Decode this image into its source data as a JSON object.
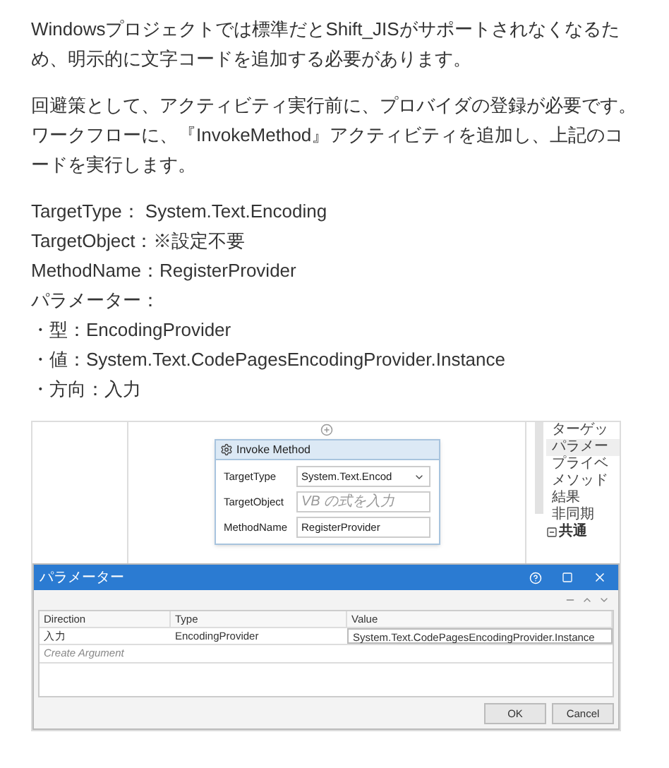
{
  "paragraphs": [
    "Windowsプロジェクトでは標準だとShift_JISがサポートされなくなるため、明示的に文字コードを追加する必要があります。",
    "回避策として、アクティビティ実行前に、プロバイダの登録が必要です。ワークフローに、『InvokeMethod』アクティビティを追加し、上記のコードを実行します。"
  ],
  "settings": [
    "TargetType： System.Text.Encoding",
    "TargetObject：※設定不要",
    "MethodName：RegisterProvider",
    "パラメーター：",
    "・型：EncodingProvider",
    "・値：System.Text.CodePagesEncodingProvider.Instance",
    "・方向：入力"
  ],
  "screenshot": {
    "activity": {
      "title": "Invoke Method",
      "fields": [
        {
          "label": "TargetType",
          "kind": "select",
          "value": "System.Text.Encod"
        },
        {
          "label": "TargetObject",
          "kind": "input",
          "placeholder": "VB の式を入力"
        },
        {
          "label": "MethodName",
          "kind": "input",
          "value": "RegisterProvider"
        }
      ]
    },
    "properties": {
      "items": [
        "ターゲッ",
        "パラメー",
        "プライベ",
        "メソッド",
        "結果",
        "非同期"
      ],
      "group": {
        "label": "共通",
        "expanded": true
      }
    },
    "dialog": {
      "title": "パラメーター",
      "columns": [
        "Direction",
        "Type",
        "Value"
      ],
      "rows": [
        [
          "入力",
          "EncodingProvider",
          "System.Text.CodePagesEncodingProvider.Instance"
        ]
      ],
      "create_row": "Create Argument",
      "buttons": [
        "OK",
        "Cancel"
      ]
    }
  }
}
